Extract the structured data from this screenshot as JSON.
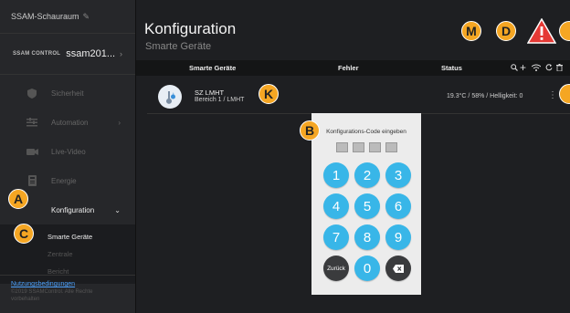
{
  "sidebar": {
    "showroom": "SSAM-Schauraum",
    "brand_logo": "SSAM CONTROL",
    "brand_name": "ssam201...",
    "items": [
      {
        "label": "Sicherheit",
        "icon": "shield-icon"
      },
      {
        "label": "Automation",
        "icon": "sliders-icon"
      },
      {
        "label": "Live-Video",
        "icon": "camera-icon"
      },
      {
        "label": "Energie",
        "icon": "meter-icon"
      },
      {
        "label": "Konfiguration",
        "icon": "config-icon"
      }
    ],
    "sub_items": [
      "Smarte Geräte",
      "Zentrale",
      "Bericht"
    ],
    "footer_link": "Nutzungsbedingungen",
    "footer_copy_1": "©2019 SSAMControl. Alle Rechte",
    "footer_copy_2": "vorbehalten"
  },
  "main": {
    "title": "Konfiguration",
    "subtitle": "Smarte Geräte",
    "columns": [
      "Smarte Geräte",
      "Fehler",
      "Status"
    ],
    "device": {
      "name": "SZ LMHT",
      "area": "Bereich 1 / LMHT",
      "status": "19.3°C / 58% / Helligkeit: 0"
    }
  },
  "keypad": {
    "title": "Konfigurations-Code eingeben",
    "keys": [
      "1",
      "2",
      "3",
      "4",
      "5",
      "6",
      "7",
      "8",
      "9"
    ],
    "back_label": "Zurück",
    "zero": "0"
  },
  "badges": {
    "a": "A",
    "b": "B",
    "c": "C",
    "d": "D",
    "k": "K",
    "m": "M"
  },
  "colors": {
    "accent": "#38b6e8",
    "badge": "#f5a623",
    "warning": "#e53935"
  }
}
